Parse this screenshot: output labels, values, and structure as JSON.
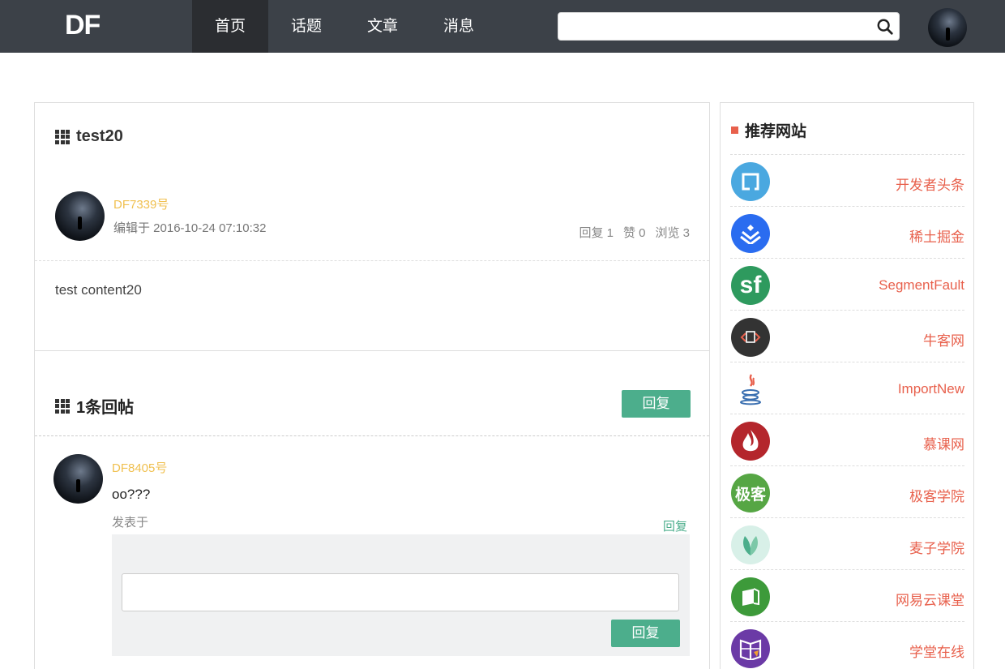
{
  "header": {
    "logo": "DF",
    "nav": [
      {
        "label": "首页",
        "active": true
      },
      {
        "label": "话题",
        "active": false
      },
      {
        "label": "文章",
        "active": false
      },
      {
        "label": "消息",
        "active": false
      }
    ],
    "search_placeholder": ""
  },
  "post": {
    "title": "test20",
    "author": "DF7339号",
    "edited": "编辑于 2016-10-24 07:10:32",
    "stats": {
      "replies": "回复 1",
      "likes": "赞 0",
      "views": "浏览 3"
    },
    "content": "test content20"
  },
  "replies": {
    "title": "1条回帖",
    "reply_button": "回复",
    "items": [
      {
        "author": "DF8405号",
        "text": "oo???",
        "date": "发表于",
        "reply_link": "回复"
      }
    ],
    "reply_submit": "回复"
  },
  "sidebar": {
    "title": "推荐网站",
    "sites": [
      {
        "name": "开发者头条",
        "icon": "toutiao-icon",
        "color": "#4aa8e0"
      },
      {
        "name": "稀土掘金",
        "icon": "juejin-icon",
        "color": "#2a6cf0"
      },
      {
        "name": "SegmentFault",
        "icon": "segmentfault-icon",
        "color": "#2e9a5e",
        "icon_text": "sf"
      },
      {
        "name": "牛客网",
        "icon": "nowcoder-icon",
        "color": "#333333"
      },
      {
        "name": "ImportNew",
        "icon": "java-icon",
        "color": "#ffffff"
      },
      {
        "name": "慕课网",
        "icon": "imooc-icon",
        "color": "#b4262c"
      },
      {
        "name": "极客学院",
        "icon": "jikexueyuan-icon",
        "color": "#56a644",
        "icon_text": "极客"
      },
      {
        "name": "麦子学院",
        "icon": "maiziedu-icon",
        "color": "#d8f0e8"
      },
      {
        "name": "网易云课堂",
        "icon": "163study-icon",
        "color": "#3d9a3a"
      },
      {
        "name": "学堂在线",
        "icon": "xuetangx-icon",
        "color": "#6b3aa6"
      }
    ]
  }
}
